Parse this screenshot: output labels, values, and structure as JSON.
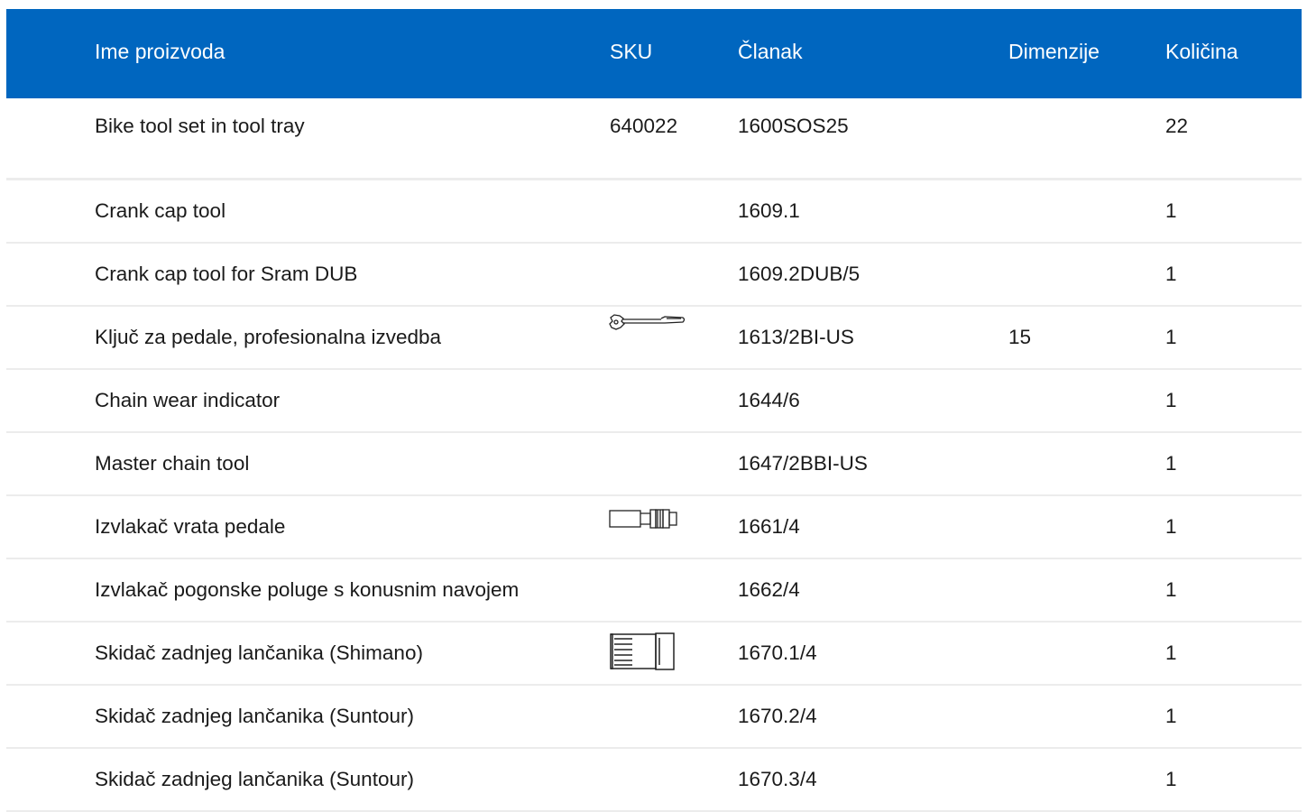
{
  "table": {
    "columns": {
      "name": "Ime proizvoda",
      "sku": "SKU",
      "article": "Članak",
      "dimensions": "Dimenzije",
      "quantity": "Količina"
    },
    "rows": [
      {
        "name": "Bike tool set in tool tray",
        "sku": "640022",
        "article": "1600SOS25",
        "dimensions": "",
        "quantity": "22",
        "thumbnail": ""
      },
      {
        "name": "Crank cap tool",
        "sku": "",
        "article": "1609.1",
        "dimensions": "",
        "quantity": "1",
        "thumbnail": ""
      },
      {
        "name": "Crank cap tool for Sram DUB",
        "sku": "",
        "article": "1609.2DUB/5",
        "dimensions": "",
        "quantity": "1",
        "thumbnail": ""
      },
      {
        "name": "Ključ za pedale, profesionalna izvedba",
        "sku": "",
        "article": "1613/2BI-US",
        "dimensions": "15",
        "quantity": "1",
        "thumbnail": "pedal-wrench-icon"
      },
      {
        "name": "Chain wear indicator",
        "sku": "",
        "article": "1644/6",
        "dimensions": "",
        "quantity": "1",
        "thumbnail": ""
      },
      {
        "name": "Master chain tool",
        "sku": "",
        "article": "1647/2BBI-US",
        "dimensions": "",
        "quantity": "1",
        "thumbnail": ""
      },
      {
        "name": "Izvlakač vrata pedale",
        "sku": "",
        "article": "1661/4",
        "dimensions": "",
        "quantity": "1",
        "thumbnail": "pedal-puller-icon"
      },
      {
        "name": "Izvlakač pogonske poluge s konusnim navojem",
        "sku": "",
        "article": "1662/4",
        "dimensions": "",
        "quantity": "1",
        "thumbnail": ""
      },
      {
        "name": "Skidač zadnjeg lančanika (Shimano)",
        "sku": "",
        "article": "1670.1/4",
        "dimensions": "",
        "quantity": "1",
        "thumbnail": "cassette-remover-icon"
      },
      {
        "name": "Skidač zadnjeg lančanika (Suntour)",
        "sku": "",
        "article": "1670.2/4",
        "dimensions": "",
        "quantity": "1",
        "thumbnail": ""
      },
      {
        "name": "Skidač zadnjeg lančanika (Suntour)",
        "sku": "",
        "article": "1670.3/4",
        "dimensions": "",
        "quantity": "1",
        "thumbnail": ""
      }
    ]
  },
  "colors": {
    "header_background": "#0066bf",
    "header_text": "#ffffff",
    "row_divider": "#ececec"
  }
}
